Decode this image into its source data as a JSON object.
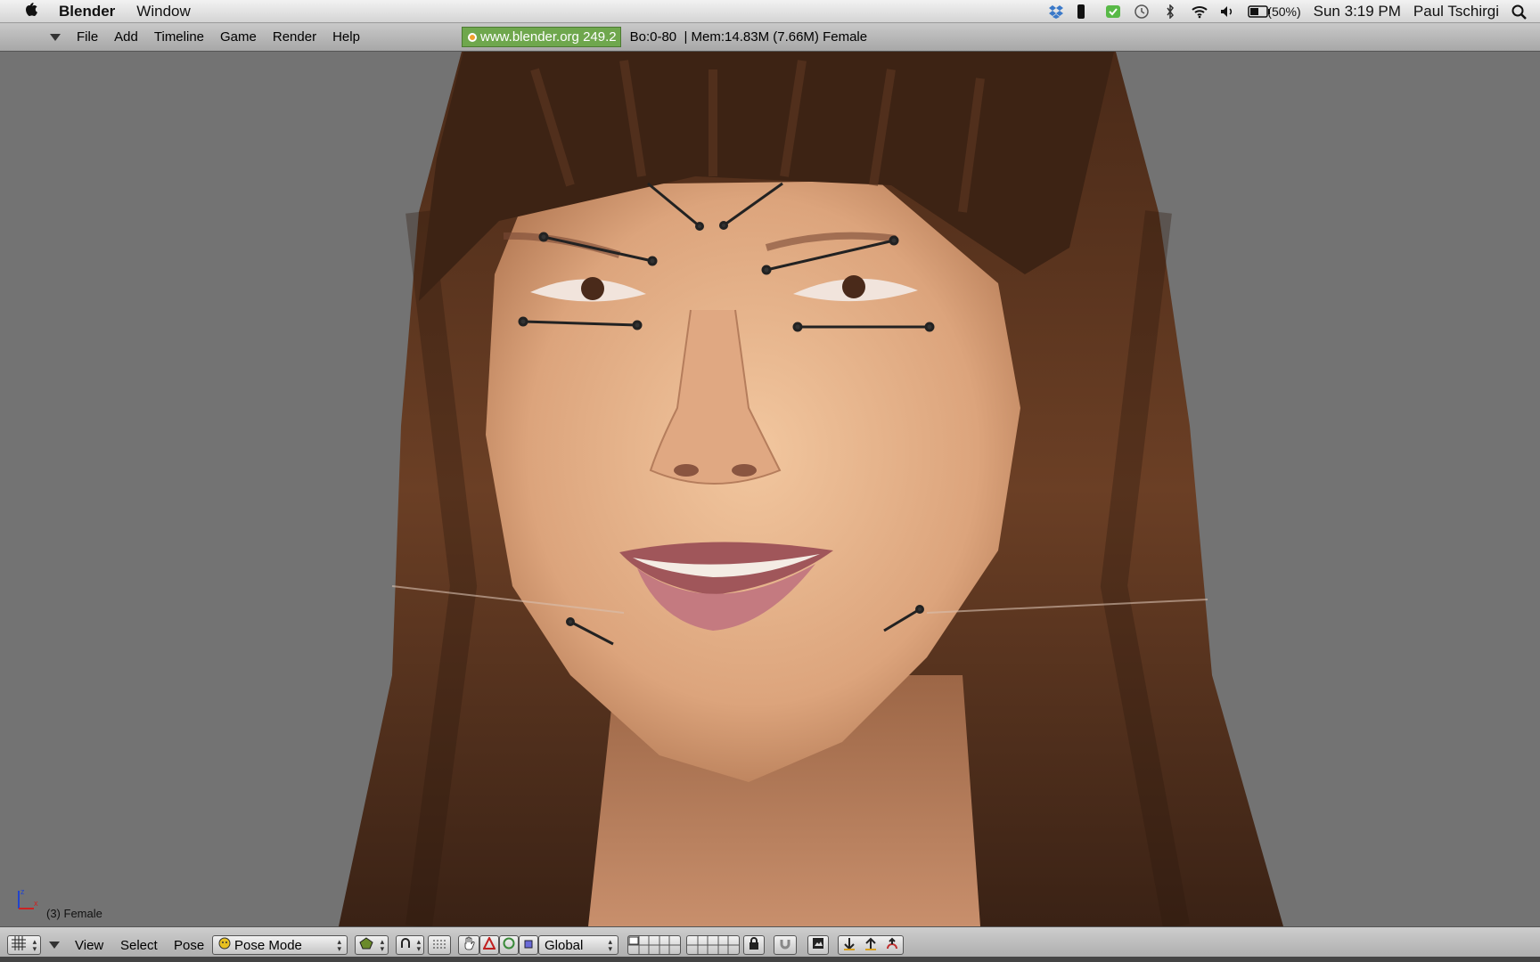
{
  "menubar": {
    "app_name": "Blender",
    "menus": [
      "Window"
    ],
    "battery": "(50%)",
    "clock": "Sun 3:19 PM",
    "user": "Paul Tschirgi"
  },
  "header": {
    "menus": [
      "File",
      "Add",
      "Timeline",
      "Game",
      "Render",
      "Help"
    ],
    "url_badge": "www.blender.org 249.2",
    "stats": "Bo:0-80  | Mem:14.83M (7.66M) Female"
  },
  "viewport": {
    "object_label": "(3) Female"
  },
  "toolbar": {
    "menus": [
      "View",
      "Select",
      "Pose"
    ],
    "mode": "Pose Mode",
    "orientation": "Global"
  },
  "colors": {
    "accent_green": "#6fa74d",
    "viewport_bg": "#737373"
  }
}
